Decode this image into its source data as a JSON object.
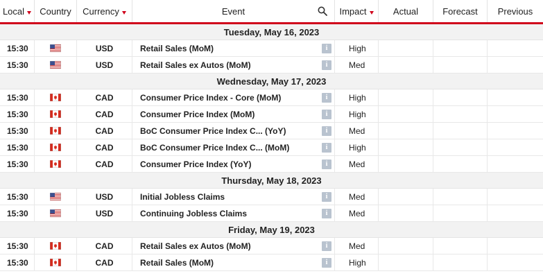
{
  "headers": {
    "local": "Local",
    "country": "Country",
    "currency": "Currency",
    "event": "Event",
    "impact": "Impact",
    "actual": "Actual",
    "forecast": "Forecast",
    "previous": "Previous"
  },
  "accent_color": "#d0021b",
  "groups": [
    {
      "date": "Tuesday, May 16, 2023",
      "rows": [
        {
          "time": "15:30",
          "flag": "us-flag-icon",
          "currency": "USD",
          "event": "Retail Sales (MoM)",
          "impact": "High",
          "actual": "",
          "forecast": "",
          "previous": ""
        },
        {
          "time": "15:30",
          "flag": "us-flag-icon",
          "currency": "USD",
          "event": "Retail Sales ex Autos (MoM)",
          "impact": "Med",
          "actual": "",
          "forecast": "",
          "previous": ""
        }
      ]
    },
    {
      "date": "Wednesday, May 17, 2023",
      "rows": [
        {
          "time": "15:30",
          "flag": "ca-flag-icon",
          "currency": "CAD",
          "event": "Consumer Price Index - Core (MoM)",
          "impact": "High",
          "actual": "",
          "forecast": "",
          "previous": ""
        },
        {
          "time": "15:30",
          "flag": "ca-flag-icon",
          "currency": "CAD",
          "event": "Consumer Price Index (MoM)",
          "impact": "High",
          "actual": "",
          "forecast": "",
          "previous": ""
        },
        {
          "time": "15:30",
          "flag": "ca-flag-icon",
          "currency": "CAD",
          "event": "BoC Consumer Price Index C...  (YoY)",
          "impact": "Med",
          "actual": "",
          "forecast": "",
          "previous": ""
        },
        {
          "time": "15:30",
          "flag": "ca-flag-icon",
          "currency": "CAD",
          "event": "BoC Consumer Price Index C...  (MoM)",
          "impact": "High",
          "actual": "",
          "forecast": "",
          "previous": ""
        },
        {
          "time": "15:30",
          "flag": "ca-flag-icon",
          "currency": "CAD",
          "event": "Consumer Price Index (YoY)",
          "impact": "Med",
          "actual": "",
          "forecast": "",
          "previous": ""
        }
      ]
    },
    {
      "date": "Thursday, May 18, 2023",
      "rows": [
        {
          "time": "15:30",
          "flag": "us-flag-icon",
          "currency": "USD",
          "event": "Initial Jobless Claims",
          "impact": "Med",
          "actual": "",
          "forecast": "",
          "previous": ""
        },
        {
          "time": "15:30",
          "flag": "us-flag-icon",
          "currency": "USD",
          "event": "Continuing Jobless Claims",
          "impact": "Med",
          "actual": "",
          "forecast": "",
          "previous": ""
        }
      ]
    },
    {
      "date": "Friday, May 19, 2023",
      "rows": [
        {
          "time": "15:30",
          "flag": "ca-flag-icon",
          "currency": "CAD",
          "event": "Retail Sales ex Autos (MoM)",
          "impact": "Med",
          "actual": "",
          "forecast": "",
          "previous": ""
        },
        {
          "time": "15:30",
          "flag": "ca-flag-icon",
          "currency": "CAD",
          "event": "Retail Sales (MoM)",
          "impact": "High",
          "actual": "",
          "forecast": "",
          "previous": ""
        }
      ]
    }
  ]
}
